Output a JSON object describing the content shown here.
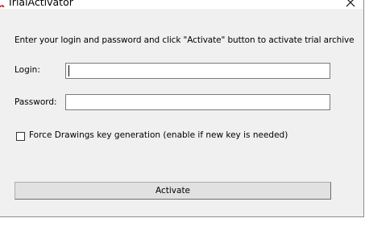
{
  "window": {
    "title": "TrialActivator",
    "icon": "app-icon"
  },
  "form": {
    "instruction": "Enter your login and password and click \"Activate\" button to activate trial archive",
    "login_label": "Login:",
    "login_value": "",
    "password_label": "Password:",
    "password_value": "",
    "force_checkbox_label": "Force Drawings key generation (enable if new key is needed)",
    "force_checked": false,
    "activate_label": "Activate"
  },
  "colors": {
    "dialog_bg": "#f0f0f0",
    "title_bg": "#ffffff",
    "icon_accent": "#d9232e"
  }
}
